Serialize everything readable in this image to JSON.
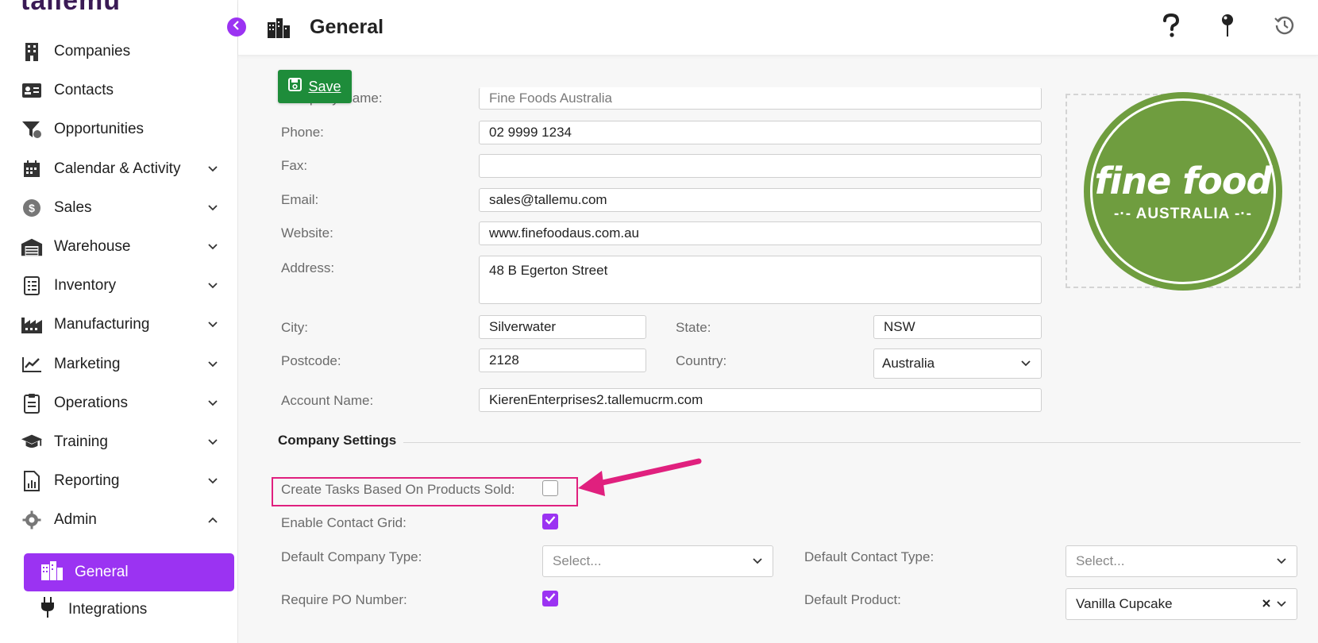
{
  "app": {
    "logo_text": "tallemu"
  },
  "sidebar": {
    "items": [
      {
        "label": "Companies",
        "icon": "building-icon",
        "chevron": ""
      },
      {
        "label": "Contacts",
        "icon": "id-card-icon",
        "chevron": ""
      },
      {
        "label": "Opportunities",
        "icon": "funnel-icon",
        "chevron": ""
      },
      {
        "label": "Calendar & Activity",
        "icon": "calendar-icon",
        "chevron": "down"
      },
      {
        "label": "Sales",
        "icon": "dollar-icon",
        "chevron": "down"
      },
      {
        "label": "Warehouse",
        "icon": "warehouse-icon",
        "chevron": "down"
      },
      {
        "label": "Inventory",
        "icon": "list-icon",
        "chevron": "down"
      },
      {
        "label": "Manufacturing",
        "icon": "factory-icon",
        "chevron": "down"
      },
      {
        "label": "Marketing",
        "icon": "chart-line-icon",
        "chevron": "down"
      },
      {
        "label": "Operations",
        "icon": "clipboard-icon",
        "chevron": "down"
      },
      {
        "label": "Training",
        "icon": "graduation-cap-icon",
        "chevron": "down"
      },
      {
        "label": "Reporting",
        "icon": "report-icon",
        "chevron": "down"
      },
      {
        "label": "Admin",
        "icon": "gear-icon",
        "chevron": "up"
      }
    ],
    "active_item": {
      "label": "General",
      "icon": "city-icon"
    },
    "sub_item": {
      "label": "Integrations",
      "icon": "plug-icon"
    }
  },
  "header": {
    "title": "General",
    "buttons": [
      "help-icon",
      "pin-icon",
      "history-icon"
    ]
  },
  "toolbar": {
    "save_label": "Save"
  },
  "form": {
    "company_name": {
      "label": "Company Name:",
      "value": "Fine Foods Australia"
    },
    "phone": {
      "label": "Phone:",
      "value": "02 9999 1234"
    },
    "fax": {
      "label": "Fax:",
      "value": ""
    },
    "email": {
      "label": "Email:",
      "value": "sales@tallemu.com"
    },
    "website": {
      "label": "Website:",
      "value": "www.finefoodaus.com.au"
    },
    "address": {
      "label": "Address:",
      "value": "48 B Egerton Street"
    },
    "city": {
      "label": "City:",
      "value": "Silverwater"
    },
    "state": {
      "label": "State:",
      "value": "NSW"
    },
    "postcode": {
      "label": "Postcode:",
      "value": "2128"
    },
    "country": {
      "label": "Country:",
      "value": "Australia"
    },
    "account_name": {
      "label": "Account Name:",
      "value": "KierenEnterprises2.tallemucrm.com"
    }
  },
  "logo_image": {
    "main": "fine food",
    "sub": "-·- AUSTRALIA -·-"
  },
  "settings": {
    "title": "Company Settings",
    "create_tasks": {
      "label": "Create Tasks Based On Products Sold:",
      "checked": false
    },
    "enable_contact_grid": {
      "label": "Enable Contact Grid:",
      "checked": true
    },
    "default_company_type": {
      "label": "Default Company Type:",
      "value": "Select..."
    },
    "default_contact_type": {
      "label": "Default Contact Type:",
      "value": "Select..."
    },
    "require_po": {
      "label": "Require PO Number:",
      "checked": true
    },
    "default_product": {
      "label": "Default Product:",
      "value": "Vanilla Cupcake"
    }
  },
  "colors": {
    "accent": "#9b33f2",
    "save": "#1e8c3a",
    "annotation": "#e0207e",
    "logo_green": "#6f9d3f"
  }
}
